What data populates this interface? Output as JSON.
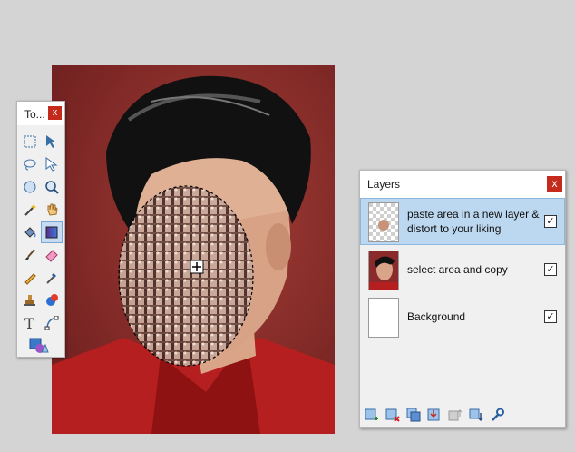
{
  "tools_window": {
    "title": "To...",
    "close": "x"
  },
  "layers_window": {
    "title": "Layers",
    "close": "x",
    "layers": [
      {
        "name": "paste area in a new layer & distort to your liking",
        "visible": true,
        "selected": true
      },
      {
        "name": "select area and copy",
        "visible": true,
        "selected": false
      },
      {
        "name": "Background",
        "visible": true,
        "selected": false
      }
    ]
  },
  "tools": [
    "rectangle-select-icon",
    "move-selected-pixels-icon",
    "lasso-select-icon",
    "move-selection-icon",
    "ellipse-select-icon",
    "zoom-icon",
    "magic-wand-icon",
    "pan-icon",
    "paint-bucket-icon",
    "gradient-icon",
    "paintbrush-icon",
    "eraser-icon",
    "pencil-icon",
    "color-picker-icon",
    "clone-stamp-icon",
    "recolor-icon",
    "text-icon",
    "line-curve-icon",
    "shapes-icon"
  ],
  "layer_buttons": [
    "add-layer-icon",
    "delete-layer-icon",
    "duplicate-layer-icon",
    "merge-layer-down-icon",
    "move-layer-up-icon",
    "move-layer-down-icon",
    "layer-properties-icon"
  ],
  "colors": {
    "accent_selected": "#bcd8f0",
    "close_red": "#c42b1c",
    "backdrop_red": "#8b2a2a"
  }
}
